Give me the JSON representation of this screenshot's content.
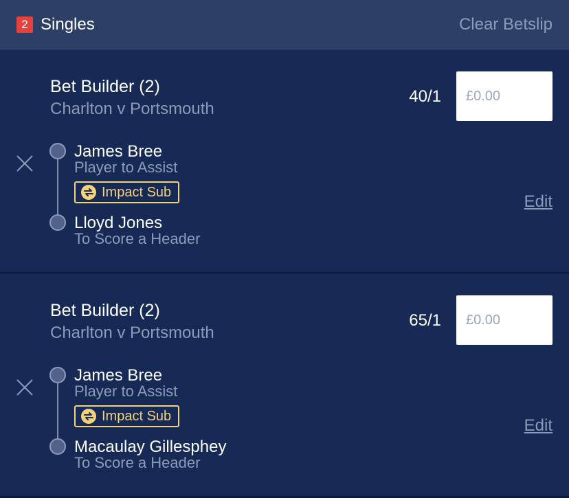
{
  "header": {
    "count": "2",
    "title": "Singles",
    "clear_label": "Clear Betslip"
  },
  "bets": [
    {
      "title": "Bet Builder (2)",
      "event": "Charlton v Portsmouth",
      "odds": "40/1",
      "stake_placeholder": "£0.00",
      "selections": [
        {
          "name": "James Bree",
          "market": "Player to Assist",
          "badge": "Impact Sub"
        },
        {
          "name": "Lloyd Jones",
          "market": "To Score a Header"
        }
      ],
      "edit_label": "Edit"
    },
    {
      "title": "Bet Builder (2)",
      "event": "Charlton v Portsmouth",
      "odds": "65/1",
      "stake_placeholder": "£0.00",
      "selections": [
        {
          "name": "James Bree",
          "market": "Player to Assist",
          "badge": "Impact Sub"
        },
        {
          "name": "Macaulay Gillesphey",
          "market": "To Score a Header"
        }
      ],
      "edit_label": "Edit"
    }
  ],
  "icons": {
    "remove": "close-icon",
    "impact": "swap-icon"
  },
  "colors": {
    "background": "#172955",
    "header": "#2c3f66",
    "badge": "#e8403c",
    "muted_text": "#8d9bb9",
    "impact_gold": "#f4d27a"
  }
}
